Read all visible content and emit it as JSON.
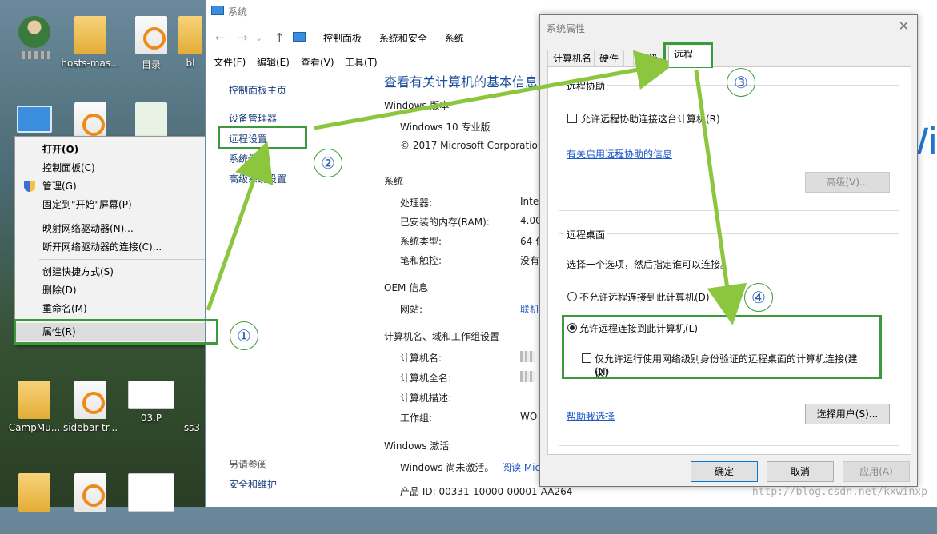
{
  "desktop": {
    "icons": [
      {
        "label": "",
        "kind": "user"
      },
      {
        "label": "hosts-mas...",
        "kind": "folder"
      },
      {
        "label": "目录",
        "kind": "uc"
      },
      {
        "label": "bl",
        "kind": "blank"
      },
      {
        "label": "CampMu...",
        "kind": "folder"
      },
      {
        "label": "sidebar-tr...",
        "kind": "uc"
      },
      {
        "label": "03.P",
        "kind": "doc"
      },
      {
        "label": "ss3",
        "kind": "blank"
      }
    ]
  },
  "context_menu": {
    "items": [
      "打开(O)",
      "控制面板(C)",
      "管理(G)",
      "固定到\"开始\"屏幕(P)",
      "映射网络驱动器(N)...",
      "断开网络驱动器的连接(C)...",
      "创建快捷方式(S)",
      "删除(D)",
      "重命名(M)",
      "属性(R)"
    ]
  },
  "system_window": {
    "title": "系统",
    "breadcrumbs": [
      "控制面板",
      "系统和安全",
      "系统"
    ],
    "menu": [
      "文件(F)",
      "编辑(E)",
      "查看(V)",
      "工具(T)"
    ],
    "left_links": [
      "控制面板主页",
      "设备管理器",
      "远程设置",
      "系统保护",
      "高级系统设置"
    ],
    "see_also_title": "另请参阅",
    "see_also_link": "安全和维护",
    "heading": "查看有关计算机的基本信息",
    "edition_title": "Windows 版本",
    "edition": "Windows 10 专业版",
    "copyright": "© 2017 Microsoft Corporation",
    "system_title": "系统",
    "processor_label": "处理器:",
    "processor_value": "Intel",
    "ram_label": "已安装的内存(RAM):",
    "ram_value": "4.00",
    "type_label": "系统类型:",
    "type_value": "64 位",
    "pen_label": "笔和触控:",
    "pen_value": "没有",
    "oem_title": "OEM 信息",
    "website_label": "网站:",
    "website_value": "联机",
    "computer_title": "计算机名、域和工作组设置",
    "computer_name_label": "计算机名:",
    "full_name_label": "计算机全名:",
    "description_label": "计算机描述:",
    "workgroup_label": "工作组:",
    "workgroup_value": "WO",
    "activation_title": "Windows 激活",
    "activation_status": "Windows 尚未激活。",
    "activation_link": "阅读 Mic",
    "product_id": "产品 ID: 00331-10000-00001-AA264",
    "logo_text": "Wi"
  },
  "dialog": {
    "title": "系统属性",
    "close": "✕",
    "tabs": [
      "计算机名",
      "硬件",
      "高级",
      "远程"
    ],
    "remote_assist_title": "远程协助",
    "allow_assist": "允许远程协助连接这台计算机(R)",
    "assist_link": "有关启用远程协助的信息",
    "advanced_button": "高级(V)...",
    "remote_desktop_title": "远程桌面",
    "choose_text": "选择一个选项，然后指定谁可以连接。",
    "option_deny": "不允许远程连接到此计算机(D)",
    "option_allow": "允许远程连接到此计算机(L)",
    "nla_option": "仅允许运行使用网络级别身份验证的远程桌面的计算机连接(建议)",
    "nla_option_suffix": "(N)",
    "help_link": "帮助我选择",
    "select_users": "选择用户(S)...",
    "ok": "确定",
    "cancel": "取消",
    "apply": "应用(A)"
  },
  "annotations": {
    "step1": "①",
    "step2": "②",
    "step3": "③",
    "step4": "④",
    "arrow_color": "#8cc63f",
    "box_color": "#3c9a3c"
  },
  "watermark": "http://blog.csdn.net/kxwinxp"
}
